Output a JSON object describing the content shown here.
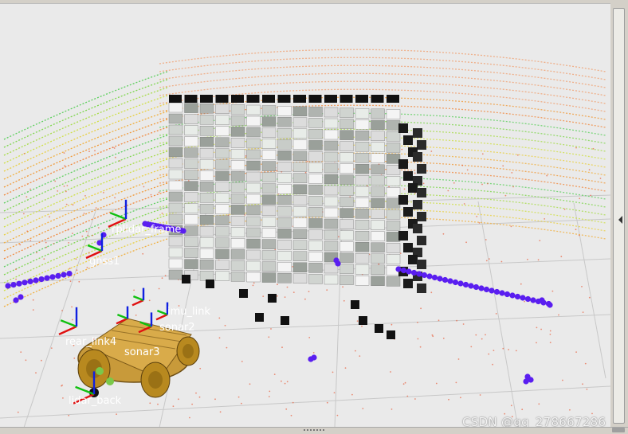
{
  "viewport": {
    "frame_labels": [
      "gnss1",
      "rear_link4",
      "sonar3",
      "lidar_back",
      "rplidar_frame",
      "sonar2",
      "imu_link"
    ],
    "watermark": "CSDN @qq_278667286"
  },
  "colors": {
    "background": "#eaeaea",
    "grid": "#c8c8c8",
    "laser_points": "#5a1ef0",
    "axis_x": "#e01010",
    "axis_y": "#10c010",
    "axis_z": "#1020e0",
    "robot_body": "#c89a3a"
  },
  "icons": {
    "collapse": "arrow-left-icon",
    "grip": "grip-icon",
    "corner": "resize-corner-icon"
  }
}
